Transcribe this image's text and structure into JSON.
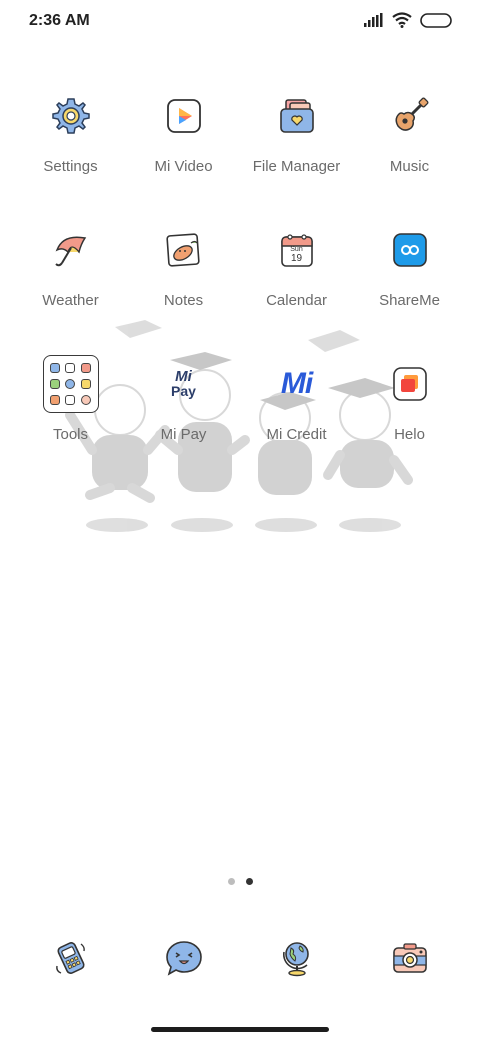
{
  "status_bar": {
    "time": "2:36 AM"
  },
  "home": {
    "rows": [
      [
        {
          "label": "Settings",
          "icon": "settings-gear-icon"
        },
        {
          "label": "Mi Video",
          "icon": "mi-video-icon"
        },
        {
          "label": "File Manager",
          "icon": "file-manager-icon"
        },
        {
          "label": "Music",
          "icon": "guitar-music-icon"
        }
      ],
      [
        {
          "label": "Weather",
          "icon": "umbrella-weather-icon"
        },
        {
          "label": "Notes",
          "icon": "notes-icon"
        },
        {
          "label": "Calendar",
          "icon": "calendar-icon"
        },
        {
          "label": "ShareMe",
          "icon": "shareme-icon"
        }
      ],
      [
        {
          "label": "Tools",
          "icon": "tools-folder-icon"
        },
        {
          "label": "Mi Pay",
          "icon": "mi-pay-icon"
        },
        {
          "label": "Mi Credit",
          "icon": "mi-credit-icon"
        },
        {
          "label": "Helo",
          "icon": "helo-icon"
        }
      ]
    ],
    "calendar_icon": {
      "month": "Sun",
      "day": "19"
    },
    "mi_pay_icon_text": {
      "top": "Mi",
      "bottom": "Pay"
    },
    "mi_credit_icon_text": "Mi",
    "page_indicator": {
      "total": 2,
      "current": 2
    }
  },
  "dock": [
    {
      "icon": "phone-icon"
    },
    {
      "icon": "messages-icon"
    },
    {
      "icon": "browser-globe-icon"
    },
    {
      "icon": "camera-icon"
    }
  ],
  "colors": {
    "label": "#6b6b6b",
    "accent_blue": "#1e9be9",
    "outline": "#333333"
  }
}
